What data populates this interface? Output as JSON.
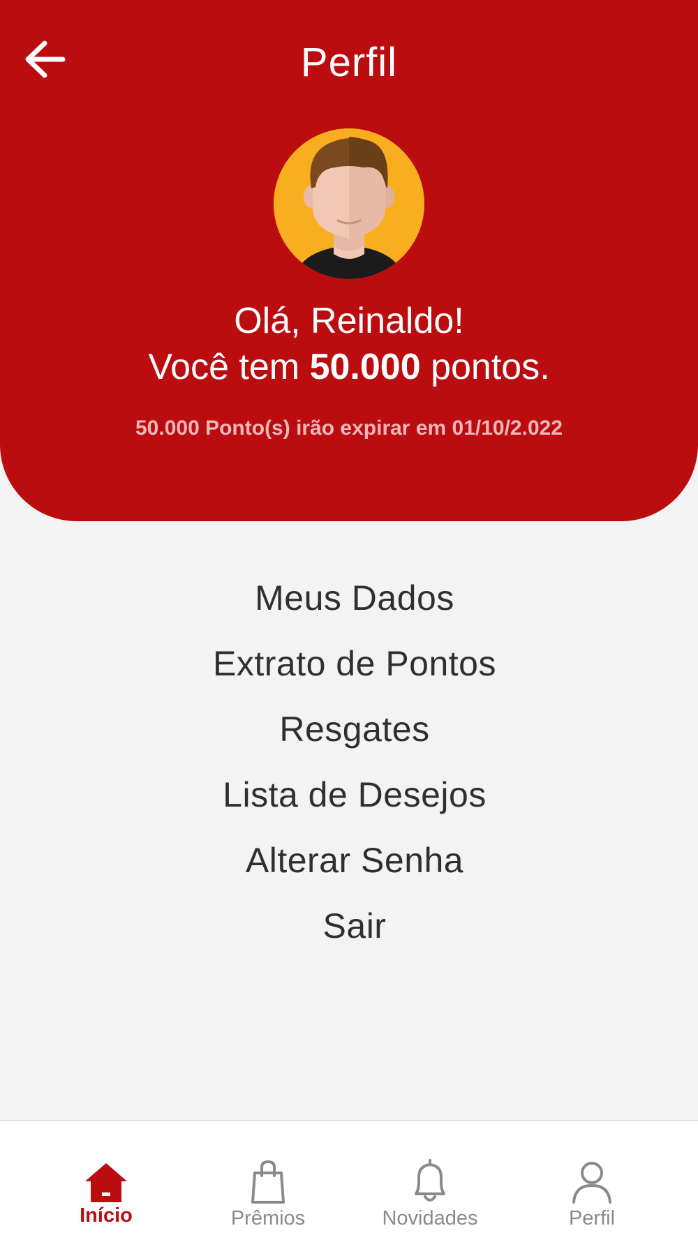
{
  "header": {
    "title": "Perfil",
    "greeting": "Olá, Reinaldo!",
    "points_prefix": "Você tem",
    "points_value": "50.000",
    "points_suffix": "pontos.",
    "expire_note": "50.000 Ponto(s) irão expirar em 01/10/2.022",
    "back_icon": "arrow-left-icon",
    "avatar_icon": "user-avatar"
  },
  "menu": {
    "items": [
      {
        "label": "Meus Dados"
      },
      {
        "label": "Extrato de Pontos"
      },
      {
        "label": "Resgates"
      },
      {
        "label": "Lista de Desejos"
      },
      {
        "label": "Alterar Senha"
      },
      {
        "label": "Sair"
      }
    ]
  },
  "tabbar": {
    "tabs": [
      {
        "label": "Início",
        "icon": "home-icon",
        "active": true
      },
      {
        "label": "Prêmios",
        "icon": "shopping-bag-icon",
        "active": false
      },
      {
        "label": "Novidades",
        "icon": "bell-icon",
        "active": false
      },
      {
        "label": "Perfil",
        "icon": "user-icon",
        "active": false
      }
    ]
  },
  "colors": {
    "brand_red": "#bb0c10",
    "background": "#f3f3f3",
    "text_dark": "#2f2f2f",
    "tab_inactive": "#8a8a8a",
    "expire_text": "#f0b7b9",
    "avatar_bg": "#f9ae1f"
  }
}
